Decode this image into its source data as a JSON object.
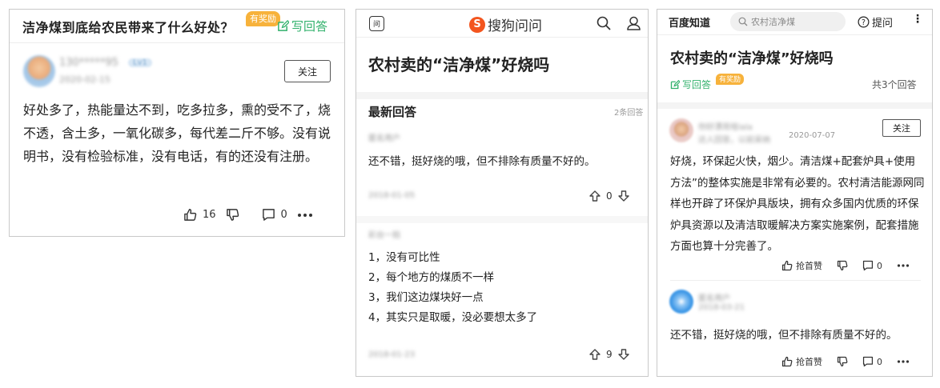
{
  "zhihu": {
    "question_title": "洁净煤到底给农民带来了什么好处？",
    "reward_badge": "有奖励",
    "write_answer": "写回答",
    "author_name": "130*****95",
    "author_level": "Lv1",
    "author_date": "2020-02-15",
    "follow_label": "关注",
    "answer_text": "好处多了，热能量达不到，吃多拉多，熏的受不了，烧不透，含土多，一氧化碳多，每代差二斤不够。没有说明书，没有检验标准，没有电话，有的还没有注册。",
    "upvote_count": "16",
    "comment_count": "0",
    "icons": [
      "thumbs-up-icon",
      "thumbs-down-icon",
      "comment-icon",
      "more-icon",
      "edit-icon"
    ],
    "colors": {
      "accent": "#32b16c",
      "reward": "#f7b23b"
    }
  },
  "sogou": {
    "header_icon_label": "问",
    "logo_letter": "S",
    "logo_text": "搜狗问问",
    "question_title": "农村卖的“洁净煤”好烧吗",
    "section_title": "最新回答",
    "section_count": "2条回答",
    "answer1": {
      "user": "匿名用户",
      "text": "还不错，挺好烧的哦，但不排除有质量不好的。",
      "date": "2018-01-05",
      "votes": "0"
    },
    "answer2": {
      "user": "彩台一拍",
      "items": [
        "1，没有可比性",
        "2，每个地方的煤质不一样",
        "3，我们这边煤块好一点",
        "4，其实只是取暖，没必要想太多了"
      ],
      "date": "2018-01-23",
      "votes": "9"
    },
    "icons": [
      "search-icon",
      "user-icon",
      "up-arrow-icon",
      "down-arrow-icon"
    ],
    "colors": {
      "brand": "#f3551e"
    }
  },
  "baidu": {
    "site_name": "百度知道",
    "search_placeholder": "农村洁净煤",
    "ask_label": "提问",
    "more_label": "⋮",
    "question_title": "农村卖的“洁净煤”好烧吗",
    "write_answer": "写回答",
    "reward_badge": "有奖励",
    "total_answers": "共3个回答",
    "answer1": {
      "name": "你好漂亮哇lala",
      "sub": "达人回答，以前采纳",
      "date": "2020-07-07",
      "follow": "关注",
      "text": "好烧，环保起火快，烟少。清洁煤+配套炉具+使用方法”的整体实施是非常有必要的。农村清洁能源网同样也开辟了环保炉具版块，拥有众多国内优质的环保炉具资源以及清洁取暖解决方案实施案例，配套措施方面也算十分完善了。",
      "first_like": "抢首赞",
      "comments": "0"
    },
    "answer2": {
      "name": "匿名用户",
      "date": "2018-03-21",
      "text": "还不错，挺好烧的哦，但不排除有质量不好的。",
      "first_like": "抢首赞",
      "comments": "0"
    },
    "icons": [
      "search-icon",
      "question-circle-icon",
      "thumbs-up-icon",
      "thumbs-down-icon",
      "comment-icon",
      "more-icon",
      "edit-icon"
    ],
    "colors": {
      "accent": "#32b16c",
      "reward": "#f7b23b"
    }
  }
}
